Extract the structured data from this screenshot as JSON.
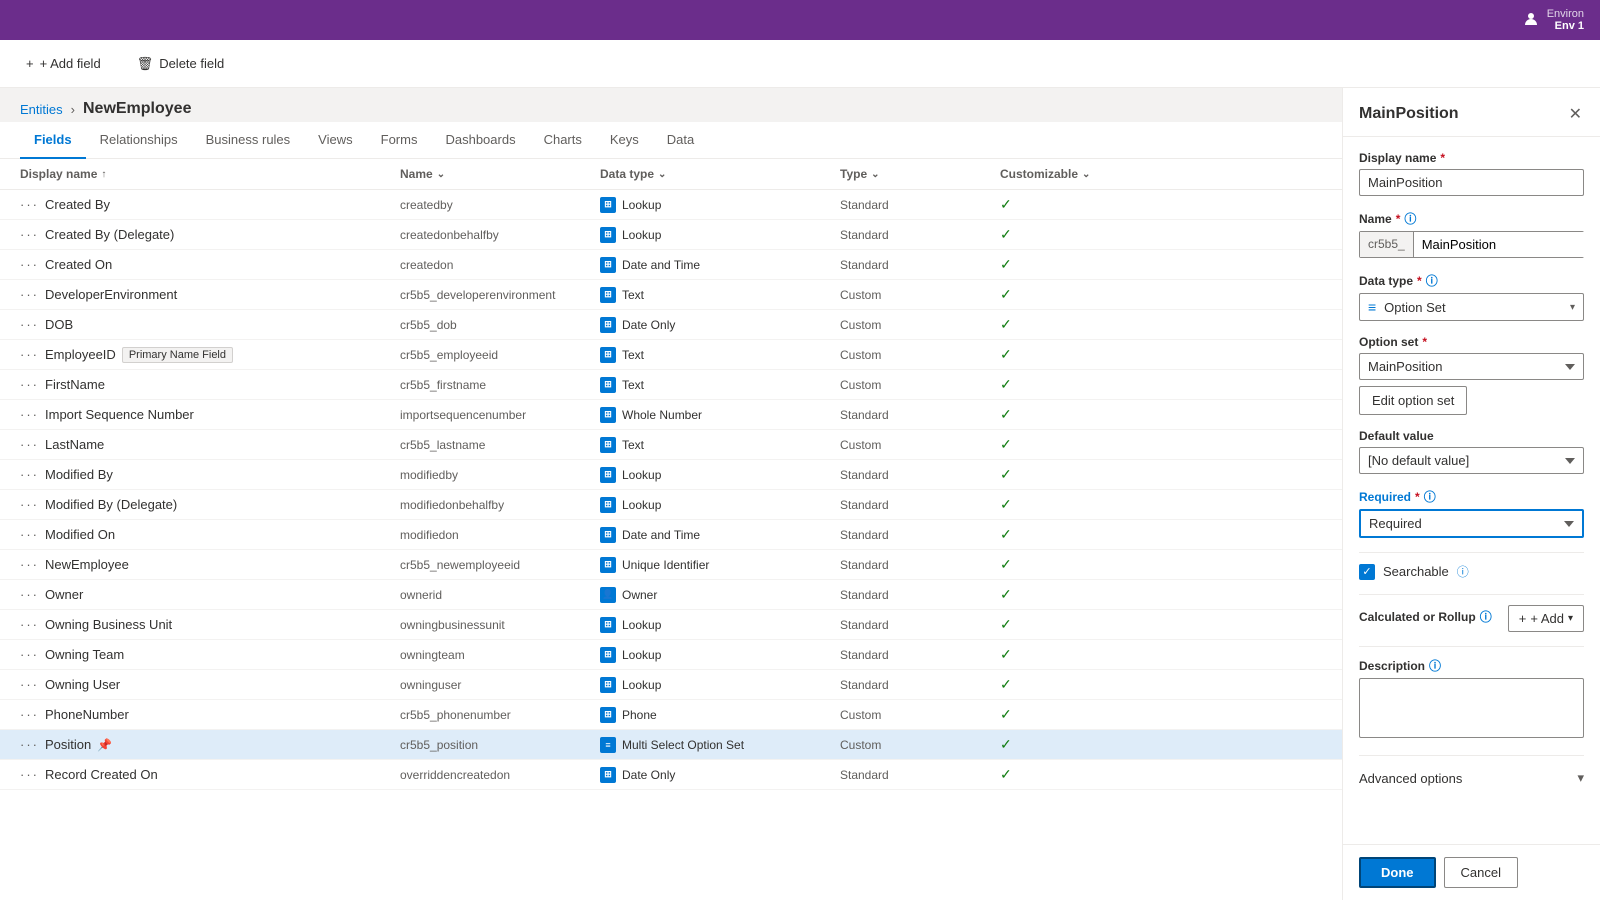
{
  "topbar": {
    "env": "Environ",
    "envLine2": "Env 1"
  },
  "toolbar": {
    "addField": "+ Add field",
    "deleteField": "Delete field"
  },
  "breadcrumb": {
    "link": "Entities",
    "separator": "›",
    "current": "NewEmployee"
  },
  "tabs": [
    {
      "label": "Fields",
      "active": true
    },
    {
      "label": "Relationships",
      "active": false
    },
    {
      "label": "Business rules",
      "active": false
    },
    {
      "label": "Views",
      "active": false
    },
    {
      "label": "Forms",
      "active": false
    },
    {
      "label": "Dashboards",
      "active": false
    },
    {
      "label": "Charts",
      "active": false
    },
    {
      "label": "Keys",
      "active": false
    },
    {
      "label": "Data",
      "active": false
    }
  ],
  "table": {
    "columns": [
      "Display name",
      "Name",
      "Data type",
      "Type",
      "Customizable"
    ],
    "rows": [
      {
        "display": "Created By",
        "name": "createdby",
        "dtype": "Lookup",
        "type": "Standard",
        "customizable": true,
        "selected": false
      },
      {
        "display": "Created By (Delegate)",
        "name": "createdonbehalfby",
        "dtype": "Lookup",
        "type": "Standard",
        "customizable": true,
        "selected": false
      },
      {
        "display": "Created On",
        "name": "createdon",
        "dtype": "Date and Time",
        "type": "Standard",
        "customizable": true,
        "selected": false
      },
      {
        "display": "DeveloperEnvironment",
        "name": "cr5b5_developerenvironment",
        "dtype": "Text",
        "type": "Custom",
        "customizable": true,
        "selected": false
      },
      {
        "display": "DOB",
        "name": "cr5b5_dob",
        "dtype": "Date Only",
        "type": "Custom",
        "customizable": true,
        "selected": false
      },
      {
        "display": "EmployeeID",
        "name": "cr5b5_employeeid",
        "dtype": "Text",
        "type": "Custom",
        "customizable": true,
        "selected": false,
        "badge": "Primary Name Field"
      },
      {
        "display": "FirstName",
        "name": "cr5b5_firstname",
        "dtype": "Text",
        "type": "Custom",
        "customizable": true,
        "selected": false
      },
      {
        "display": "Import Sequence Number",
        "name": "importsequencenumber",
        "dtype": "Whole Number",
        "type": "Standard",
        "customizable": true,
        "selected": false
      },
      {
        "display": "LastName",
        "name": "cr5b5_lastname",
        "dtype": "Text",
        "type": "Custom",
        "customizable": true,
        "selected": false
      },
      {
        "display": "Modified By",
        "name": "modifiedby",
        "dtype": "Lookup",
        "type": "Standard",
        "customizable": true,
        "selected": false
      },
      {
        "display": "Modified By (Delegate)",
        "name": "modifiedonbehalfby",
        "dtype": "Lookup",
        "type": "Standard",
        "customizable": true,
        "selected": false
      },
      {
        "display": "Modified On",
        "name": "modifiedon",
        "dtype": "Date and Time",
        "type": "Standard",
        "customizable": true,
        "selected": false
      },
      {
        "display": "NewEmployee",
        "name": "cr5b5_newemployeeid",
        "dtype": "Unique Identifier",
        "type": "Standard",
        "customizable": true,
        "selected": false
      },
      {
        "display": "Owner",
        "name": "ownerid",
        "dtype": "Owner",
        "type": "Standard",
        "customizable": true,
        "selected": false
      },
      {
        "display": "Owning Business Unit",
        "name": "owningbusinessunit",
        "dtype": "Lookup",
        "type": "Standard",
        "customizable": true,
        "selected": false
      },
      {
        "display": "Owning Team",
        "name": "owningteam",
        "dtype": "Lookup",
        "type": "Standard",
        "customizable": true,
        "selected": false
      },
      {
        "display": "Owning User",
        "name": "owninguser",
        "dtype": "Lookup",
        "type": "Standard",
        "customizable": true,
        "selected": false
      },
      {
        "display": "PhoneNumber",
        "name": "cr5b5_phonenumber",
        "dtype": "Phone",
        "type": "Custom",
        "customizable": true,
        "selected": false
      },
      {
        "display": "Position",
        "name": "cr5b5_position",
        "dtype": "Multi Select Option Set",
        "type": "Custom",
        "customizable": true,
        "selected": true,
        "pinned": true
      },
      {
        "display": "Record Created On",
        "name": "overriddencreatedon",
        "dtype": "Date Only",
        "type": "Standard",
        "customizable": true,
        "selected": false
      }
    ]
  },
  "panel": {
    "title": "MainPosition",
    "displayName": {
      "label": "Display name",
      "required": true,
      "value": "MainPosition"
    },
    "name": {
      "label": "Name",
      "required": true,
      "prefix": "cr5b5_",
      "value": "MainPosition"
    },
    "dataType": {
      "label": "Data type",
      "required": true,
      "value": "Option Set",
      "icon": "≡"
    },
    "optionSet": {
      "label": "Option set",
      "required": true,
      "value": "MainPosition",
      "editBtn": "Edit option set"
    },
    "defaultValue": {
      "label": "Default value",
      "value": "[No default value]"
    },
    "required": {
      "label": "Required",
      "required": true,
      "value": "Required"
    },
    "searchable": {
      "label": "Searchable",
      "checked": true
    },
    "calculatedOrRollup": {
      "label": "Calculated or Rollup",
      "addLabel": "+ Add"
    },
    "description": {
      "label": "Description",
      "placeholder": ""
    },
    "advancedOptions": {
      "label": "Advanced options"
    },
    "buttons": {
      "done": "Done",
      "cancel": "Cancel"
    }
  }
}
